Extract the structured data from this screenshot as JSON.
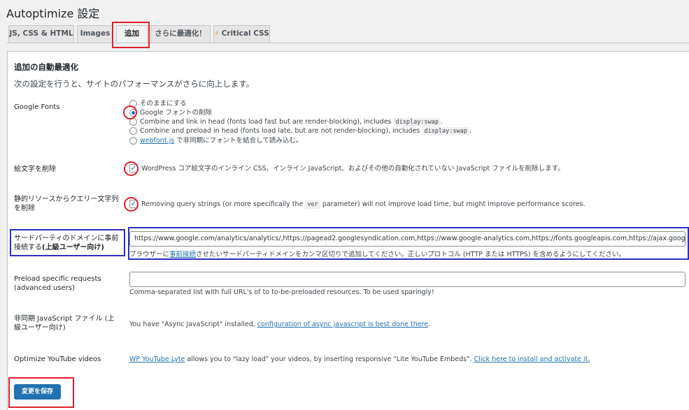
{
  "page": {
    "title": "Autoptimize 設定"
  },
  "tabs": [
    {
      "label": "JS, CSS & HTML"
    },
    {
      "label": "Images"
    },
    {
      "label": "追加"
    },
    {
      "label": "さらに最適化！"
    },
    {
      "label": "Critical CSS",
      "icon": "lightning-bolt-icon"
    }
  ],
  "section": {
    "heading": "追加の自動最適化",
    "description": "次の設定を行うと、サイトのパフォーマンスがさらに向上します。"
  },
  "google_fonts": {
    "label": "Google Fonts",
    "options": [
      {
        "text": "そのままにする",
        "checked": false
      },
      {
        "text": "Google フォントの削除",
        "checked": true
      },
      {
        "text": "Combine and link in head (fonts load fast but are render-blocking), includes",
        "code": "display:swap",
        "suffix": ".",
        "checked": false
      },
      {
        "text": "Combine and preload in head (fonts load late, but are not render-blocking), includes",
        "code": "display:swap",
        "suffix": ".",
        "checked": false
      },
      {
        "link": "webfont.js",
        "text": " で非同期にフォントを結合して読み込む。",
        "checked": false
      }
    ]
  },
  "emoji": {
    "label": "絵文字を削除",
    "text": "WordPress コア絵文字のインライン CSS、インライン JavaScript、およびその他の自動化されていない JavaScript ファイルを削除します。",
    "checked": true
  },
  "query_strings": {
    "label": "静的リソースからクエリー文字列を削除",
    "text_before": "Removing query strings (or more specifically the",
    "code": "ver",
    "text_after": "parameter) will not improve load time, but might improve performance scores.",
    "checked": true
  },
  "preconnect": {
    "label": "サードパーティのドメインに事前接続する",
    "label_bold": "(上級ユーザー向け)",
    "value": "https://www.google.com/analytics/analytics/,https://pagead2.googlesyndication.com,https://www.google-analytics.com,https://fonts.googleapis.com,https://ajax.googleapis.com",
    "hint_before": "ブラウザーに",
    "hint_link": "事前接続",
    "hint_after": "させたいサードパーティドメインをカンマ区切りで追加してください。正しいプロトコル (HTTP または HTTPS) を含めるようにしてください。"
  },
  "preload": {
    "label_line1": "Preload specific requests",
    "label_line2": "(advanced users)",
    "value": "",
    "hint": "Comma-separated list with full URL's of to to-be-preloaded resources. To be used sparingly!"
  },
  "async_js": {
    "label": "非同期 JavaScript ファイル (上級ユーザー向け)",
    "text_before": "You have \"Async JavaScript\" installed, ",
    "link": "configuration of async javascript is best done there",
    "text_after": "."
  },
  "youtube": {
    "label": "Optimize YouTube videos",
    "link1": "WP YouTube Lyte",
    "text": " allows you to \"lazy load\" your videos, by inserting responsive \"Lite YouTube Embeds\". ",
    "link2": "Click here to install and activate it."
  },
  "save": {
    "label": "変更を保存"
  }
}
